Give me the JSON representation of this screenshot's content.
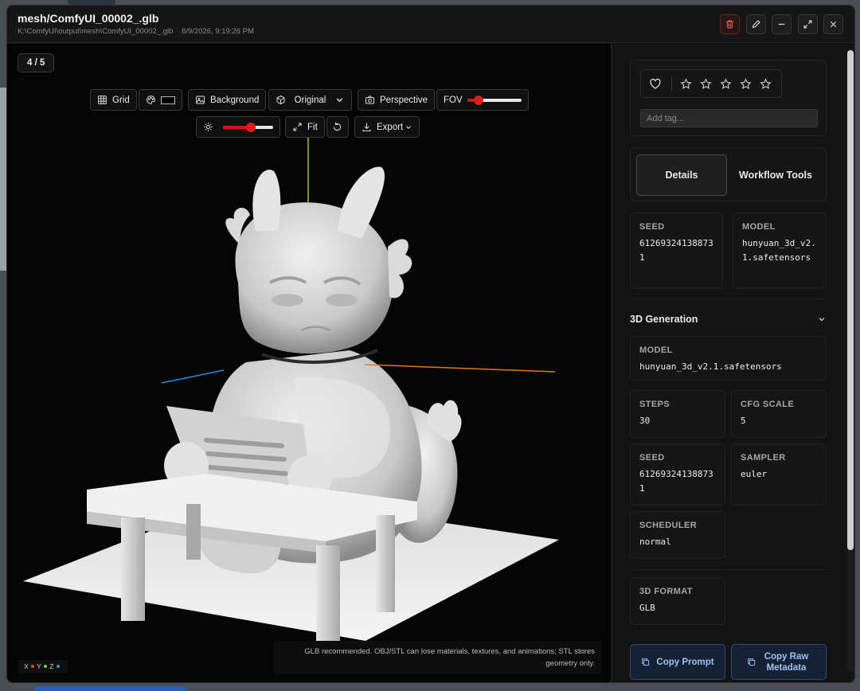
{
  "window": {
    "title": "mesh/ComfyUI_00002_.glb",
    "path": "K:\\ComfyUI\\output\\mesh\\ComfyUI_00002_.glb",
    "timestamp": "8/9/2026, 9:19:26 PM"
  },
  "titlebar_buttons": [
    "trash-icon",
    "pencil-icon",
    "minimize-icon",
    "expand-icon",
    "close-icon"
  ],
  "viewer": {
    "counter": "4 / 5",
    "toolbar": {
      "grid": "Grid",
      "background": "Background",
      "material": "Original",
      "camera": "Perspective",
      "fov": "FOV",
      "fit": "Fit",
      "export": "Export"
    },
    "fov_level": 0.15,
    "light_level": 0.5,
    "export_hint": "GLB recommended. OBJ/STL can lose materials, textures, and animations; STL stores geometry only.",
    "axes": {
      "x": "X",
      "y": "Y",
      "z": "Z"
    },
    "axis_colors": {
      "x": "#e0453a",
      "y": "#7ccf3a",
      "z": "#3a8fe0"
    }
  },
  "sidebar": {
    "rating": {
      "favorited": false,
      "stars": 0
    },
    "tag_placeholder": "Add tag...",
    "tabs": {
      "details": "Details",
      "workflow": "Workflow Tools"
    },
    "summary": {
      "seed_label": "SEED",
      "seed_value": "612693241388731",
      "model_label": "MODEL",
      "model_value": "hunyuan_3d_v2.1.safetensors"
    },
    "section": "3D Generation",
    "gen": {
      "model_label": "MODEL",
      "model_value": "hunyuan_3d_v2.1.safetensors",
      "steps_label": "STEPS",
      "steps_value": "30",
      "cfg_label": "CFG SCALE",
      "cfg_value": "5",
      "seed_label": "SEED",
      "seed_value": "612693241388731",
      "sampler_label": "SAMPLER",
      "sampler_value": "euler",
      "scheduler_label": "SCHEDULER",
      "scheduler_value": "normal",
      "format_label": "3D FORMAT",
      "format_value": "GLB"
    },
    "copy_prompt": "Copy Prompt",
    "copy_raw": "Copy Raw Metadata"
  }
}
